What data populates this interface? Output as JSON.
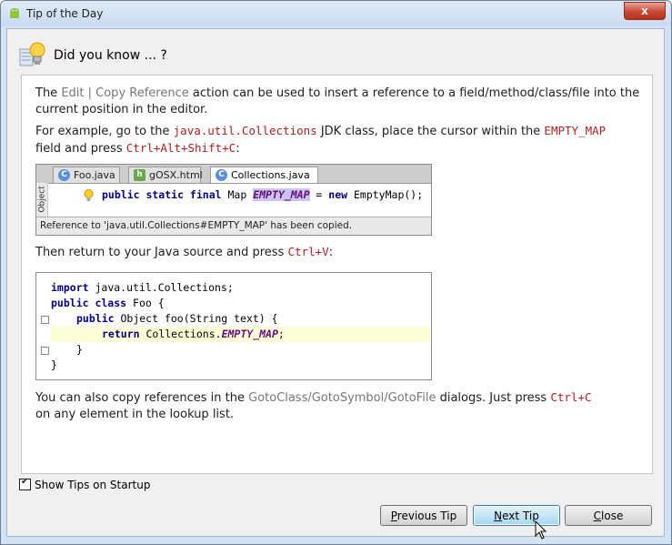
{
  "window": {
    "title": "Tip of the Day",
    "close_glyph": "x"
  },
  "header": {
    "title": "Did you know ... ?",
    "icon": "lightbulb-icon"
  },
  "tip": {
    "p1_the": "The ",
    "p1_action_edit": "Edit",
    "p1_action_sep": " | ",
    "p1_action_copy": "Copy Reference",
    "p1_rest": " action can be used to insert a reference to a field/method/class/file into the current position in the editor.",
    "p2_a": "For example, go to the ",
    "p2_class": "java.util.Collections",
    "p2_b": " JDK class, place the cursor within the ",
    "p2_field": "EMPTY_MAP",
    "p2_c": " field and press ",
    "p2_keys": "Ctrl+Alt+Shift+C",
    "p2_d": ":",
    "p3_a": "Then return to your Java source and press ",
    "p3_keys": "Ctrl+V",
    "p3_b": ":",
    "p4_a": "You can also copy references in the ",
    "p4_dialogs": "GotoClass/GotoSymbol/GotoFile",
    "p4_b": " dialogs. Just press ",
    "p4_keys": "Ctrl+C",
    "p4_c": " on any element in the lookup list."
  },
  "screenshot1": {
    "tabs": [
      {
        "label": "Foo.java",
        "icon": "class-file-icon",
        "icon_text": "C"
      },
      {
        "label": "gOSX.html",
        "icon": "html-file-icon",
        "icon_text": "h"
      },
      {
        "label": "Collections.java",
        "icon": "class-file-icon",
        "icon_text": "C"
      }
    ],
    "side_label": "Object",
    "code": {
      "kw1": "public static final",
      "type": " Map ",
      "field": "EMPTY_MAP",
      "eq": " = ",
      "kw2": "new",
      "rest": " EmptyMap();"
    },
    "status": "Reference to 'java.util.Collections#EMPTY_MAP' has been copied."
  },
  "screenshot2": {
    "lines": [
      {
        "kw": "import",
        "text": " java.util.Collections;"
      },
      {
        "kw": "public class",
        "text": " Foo {"
      },
      {
        "kw": "public",
        "text": " Object foo(String text) {"
      },
      {
        "kw": "return",
        "text": " Collections.",
        "field": "EMPTY_MAP",
        "end": ";"
      },
      {
        "kw": "",
        "text": "}"
      },
      {
        "kw": "",
        "text": "}"
      }
    ]
  },
  "footer": {
    "show_tips_label": "Show Tips on Startup",
    "show_tips_checked": true,
    "previous_label_u": "P",
    "previous_label_rest": "revious Tip",
    "next_label_u": "N",
    "next_label_rest": "ext Tip",
    "close_label_u": "C",
    "close_label_rest": "lose"
  }
}
